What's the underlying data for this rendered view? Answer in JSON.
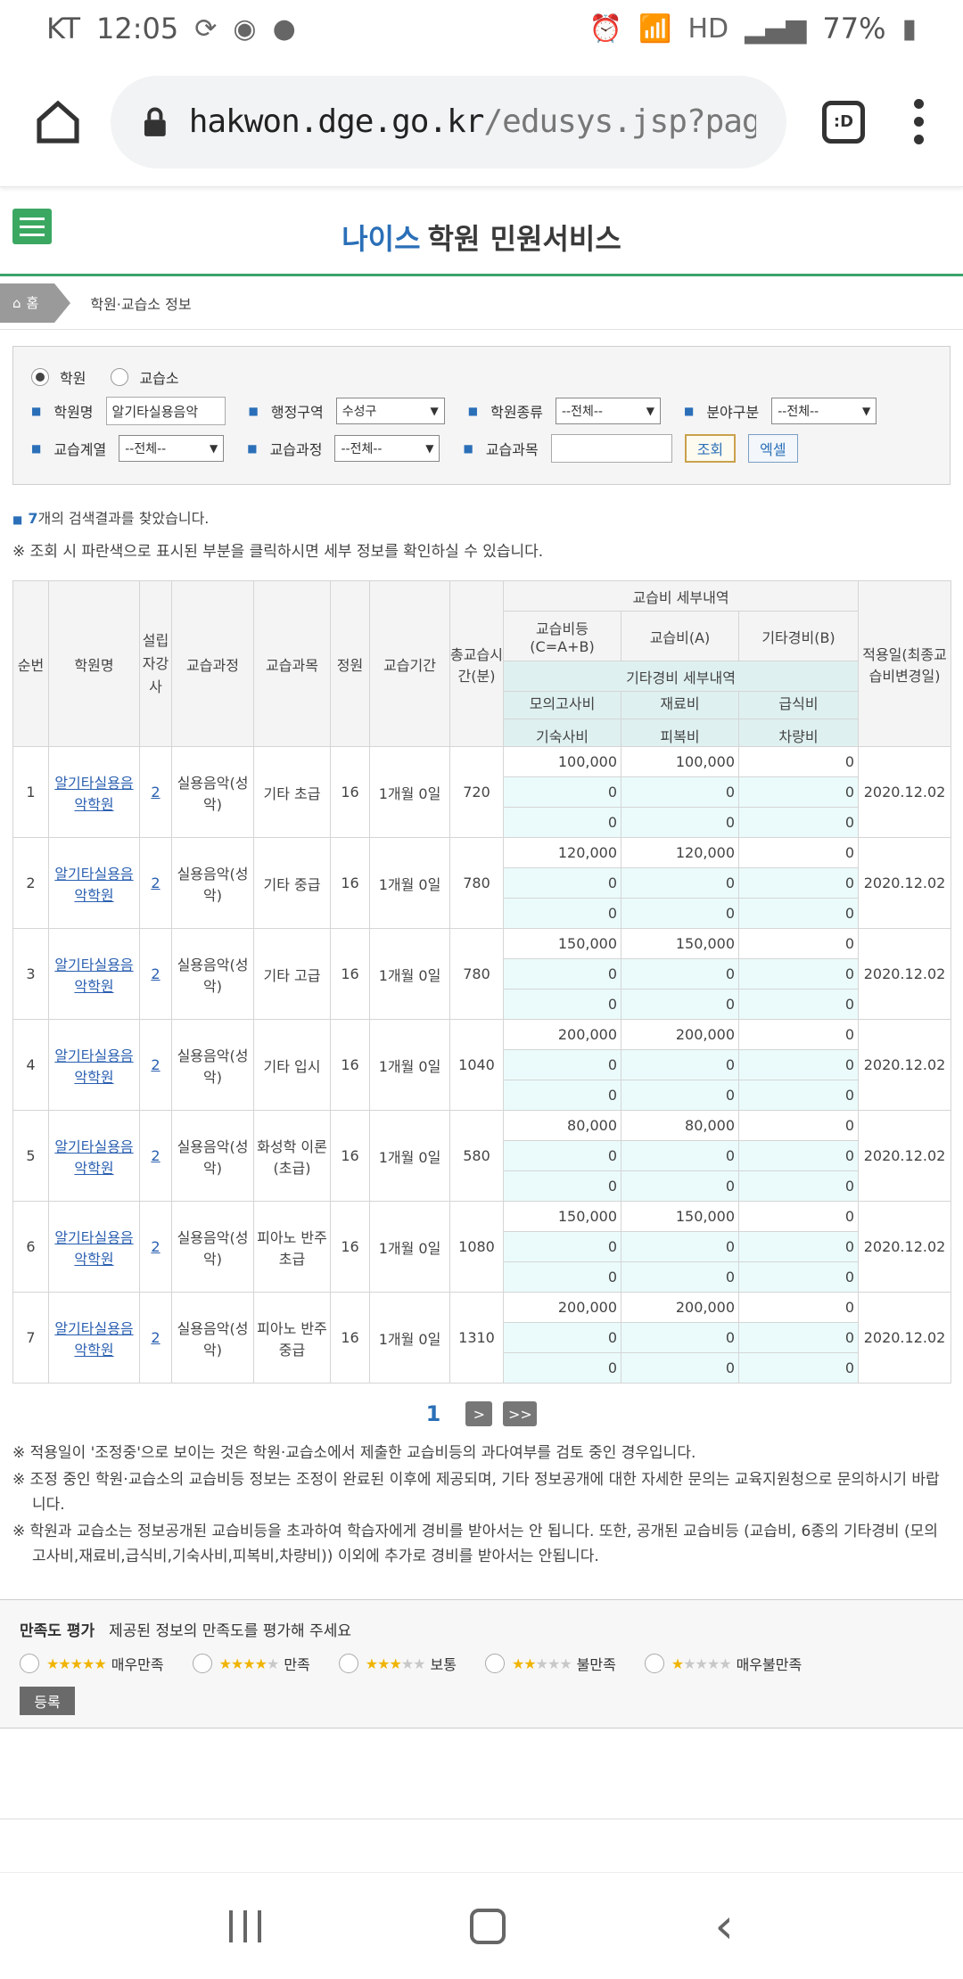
{
  "status": {
    "carrier": "KT",
    "time": "12:05",
    "hd": "HD",
    "battery": "77%"
  },
  "browser": {
    "url_host": "hakwon.dge.go.kr",
    "url_path": "/edusys.jsp?page=",
    "tab_label": ":D"
  },
  "site": {
    "logo_brand": "나이스",
    "logo_service": "학원 민원서비스"
  },
  "breadcrumb": {
    "home": "홈",
    "current": "학원·교습소 정보"
  },
  "search": {
    "radio_academy": "학원",
    "radio_tutor": "교습소",
    "name_label": "학원명",
    "name_value": "알기타실용음악",
    "region_label": "행정구역",
    "region_value": "수성구",
    "type_label": "학원종류",
    "type_value": "--전체--",
    "field_label": "분야구분",
    "field_value": "--전체--",
    "series_label": "교습계열",
    "series_value": "--전체--",
    "course_label": "교습과정",
    "course_value": "--전체--",
    "subject_label": "교습과목",
    "subject_value": "",
    "search_btn": "조회",
    "excel_btn": "엑셀"
  },
  "result": {
    "count": "7",
    "count_suffix": "개의 검색결과를 찾았습니다.",
    "note": "※ 조회 시 파란색으로 표시된 부분을 클릭하시면 세부 정보를 확인하실 수 있습니다."
  },
  "table": {
    "headers": {
      "no": "순번",
      "name": "학원명",
      "instructor": "설립자강사",
      "course": "교습과정",
      "subject": "교습과목",
      "capacity": "정원",
      "period": "교습기간",
      "total_time": "총교습시간(분)",
      "fee_detail": "교습비 세부내역",
      "fee_total": "교습비등(C=A+B)",
      "fee_a": "교습비(A)",
      "fee_b": "기타경비(B)",
      "apply_date": "적용일(최종교습비변경일)",
      "other_detail": "기타경비 세부내역",
      "mock": "모의고사비",
      "material": "재료비",
      "meal": "급식비",
      "dorm": "기숙사비",
      "clothes": "피복비",
      "vehicle": "차량비"
    },
    "rows": [
      {
        "no": "1",
        "name": "알기타실용음악학원",
        "instructor": "2",
        "course": "실용음악(성악)",
        "subject": "기타 초급",
        "capacity": "16",
        "period": "1개월 0일",
        "time": "720",
        "total": "100,000",
        "a": "100,000",
        "b": "0",
        "mock": "0",
        "material": "0",
        "meal": "0",
        "dorm": "0",
        "clothes": "0",
        "vehicle": "0",
        "date": "2020.12.02"
      },
      {
        "no": "2",
        "name": "알기타실용음악학원",
        "instructor": "2",
        "course": "실용음악(성악)",
        "subject": "기타 중급",
        "capacity": "16",
        "period": "1개월 0일",
        "time": "780",
        "total": "120,000",
        "a": "120,000",
        "b": "0",
        "mock": "0",
        "material": "0",
        "meal": "0",
        "dorm": "0",
        "clothes": "0",
        "vehicle": "0",
        "date": "2020.12.02"
      },
      {
        "no": "3",
        "name": "알기타실용음악학원",
        "instructor": "2",
        "course": "실용음악(성악)",
        "subject": "기타 고급",
        "capacity": "16",
        "period": "1개월 0일",
        "time": "780",
        "total": "150,000",
        "a": "150,000",
        "b": "0",
        "mock": "0",
        "material": "0",
        "meal": "0",
        "dorm": "0",
        "clothes": "0",
        "vehicle": "0",
        "date": "2020.12.02"
      },
      {
        "no": "4",
        "name": "알기타실용음악학원",
        "instructor": "2",
        "course": "실용음악(성악)",
        "subject": "기타 입시",
        "capacity": "16",
        "period": "1개월 0일",
        "time": "1040",
        "total": "200,000",
        "a": "200,000",
        "b": "0",
        "mock": "0",
        "material": "0",
        "meal": "0",
        "dorm": "0",
        "clothes": "0",
        "vehicle": "0",
        "date": "2020.12.02"
      },
      {
        "no": "5",
        "name": "알기타실용음악학원",
        "instructor": "2",
        "course": "실용음악(성악)",
        "subject": "화성학 이론(초급)",
        "capacity": "16",
        "period": "1개월 0일",
        "time": "580",
        "total": "80,000",
        "a": "80,000",
        "b": "0",
        "mock": "0",
        "material": "0",
        "meal": "0",
        "dorm": "0",
        "clothes": "0",
        "vehicle": "0",
        "date": "2020.12.02"
      },
      {
        "no": "6",
        "name": "알기타실용음악학원",
        "instructor": "2",
        "course": "실용음악(성악)",
        "subject": "피아노 반주 초급",
        "capacity": "16",
        "period": "1개월 0일",
        "time": "1080",
        "total": "150,000",
        "a": "150,000",
        "b": "0",
        "mock": "0",
        "material": "0",
        "meal": "0",
        "dorm": "0",
        "clothes": "0",
        "vehicle": "0",
        "date": "2020.12.02"
      },
      {
        "no": "7",
        "name": "알기타실용음악학원",
        "instructor": "2",
        "course": "실용음악(성악)",
        "subject": "피아노 반주 중급",
        "capacity": "16",
        "period": "1개월 0일",
        "time": "1310",
        "total": "200,000",
        "a": "200,000",
        "b": "0",
        "mock": "0",
        "material": "0",
        "meal": "0",
        "dorm": "0",
        "clothes": "0",
        "vehicle": "0",
        "date": "2020.12.02"
      }
    ]
  },
  "pagination": {
    "current": "1",
    "next": ">",
    "last": ">>"
  },
  "notes": [
    "※ 적용일이 '조정중'으로 보이는 것은 학원·교습소에서 제출한 교습비등의 과다여부를 검토 중인 경우입니다.",
    "※ 조정 중인 학원·교습소의 교습비등 정보는 조정이 완료된 이후에 제공되며, 기타 정보공개에 대한 자세한 문의는 교육지원청으로 문의하시기 바랍니다.",
    "※ 학원과 교습소는 정보공개된 교습비등을 초과하여 학습자에게 경비를 받아서는 안 됩니다. 또한, 공개된 교습비등 (교습비, 6종의 기타경비 (모의고사비,재료비,급식비,기숙사비,피복비,차량비)) 이외에 추가로 경비를 받아서는 안됩니다."
  ],
  "satisfaction": {
    "title": "만족도 평가",
    "subtitle": "제공된 정보의 만족도를 평가해 주세요",
    "options": [
      {
        "label": "매우만족",
        "stars": 5
      },
      {
        "label": "만족",
        "stars": 4
      },
      {
        "label": "보통",
        "stars": 3
      },
      {
        "label": "불만족",
        "stars": 2
      },
      {
        "label": "매우불만족",
        "stars": 1
      }
    ],
    "submit": "등록"
  },
  "colors": {
    "accent": "#2a6fb8",
    "green": "#3ba862",
    "teal_cell": "#ebfbfb"
  }
}
